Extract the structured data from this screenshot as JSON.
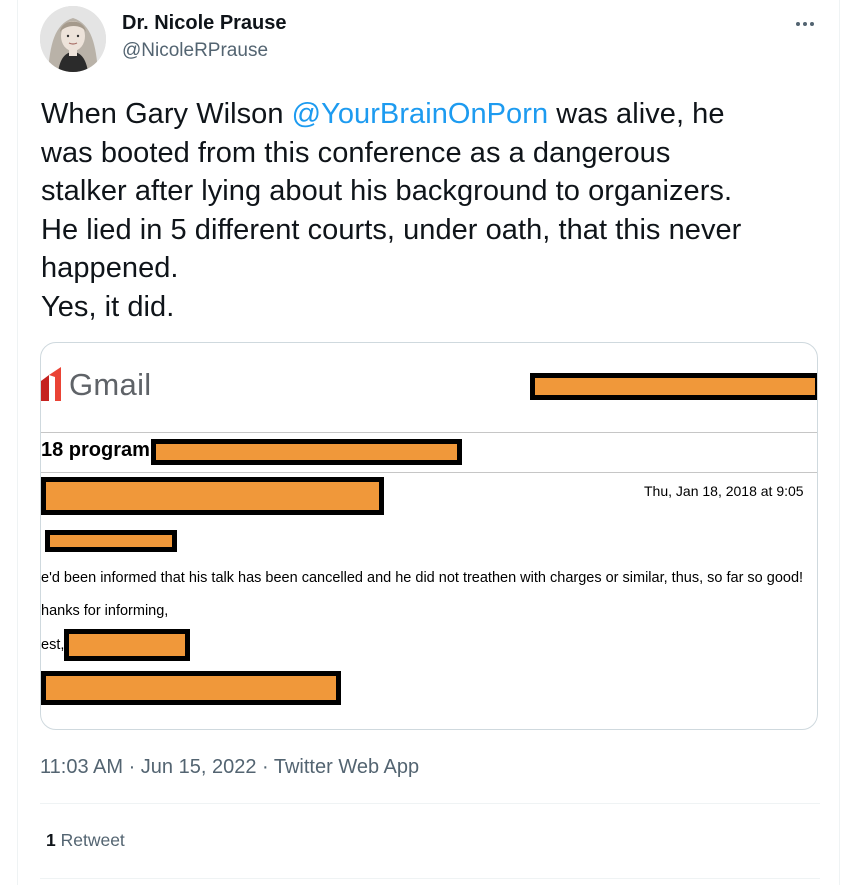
{
  "author": {
    "display_name": "Dr. Nicole Prause",
    "handle": "@NicoleRPrause"
  },
  "tweet": {
    "text_lines": [
      {
        "before": "When Gary Wilson ",
        "mention": "@YourBrainOnPorn",
        "after": " was alive, he"
      },
      {
        "text": "was booted from this conference as a dangerous"
      },
      {
        "text": "stalker after lying about his background to organizers."
      },
      {
        "text": "He lied in 5 different courts, under oath, that this never"
      },
      {
        "text": "happened."
      },
      {
        "text": "Yes, it did."
      }
    ],
    "timestamp": "11:03 AM · Jun 15, 2022 · ",
    "source_app": "Twitter Web App"
  },
  "media": {
    "gmail_label": "Gmail",
    "subject": "18 program",
    "date": "Thu, Jan 18, 2018 at 9:05",
    "body_line1": "e'd been informed that his talk has been cancelled and he did not treathen with charges or similar, thus, so far so good!",
    "body_line2": "hanks for informing,",
    "body_line3": "est,"
  },
  "stats": {
    "retweet_count": "1",
    "retweet_label": " Retweet"
  },
  "colors": {
    "link": "#1d9bf0",
    "secondary_text": "#536471",
    "redaction_fill": "#f0983a"
  }
}
